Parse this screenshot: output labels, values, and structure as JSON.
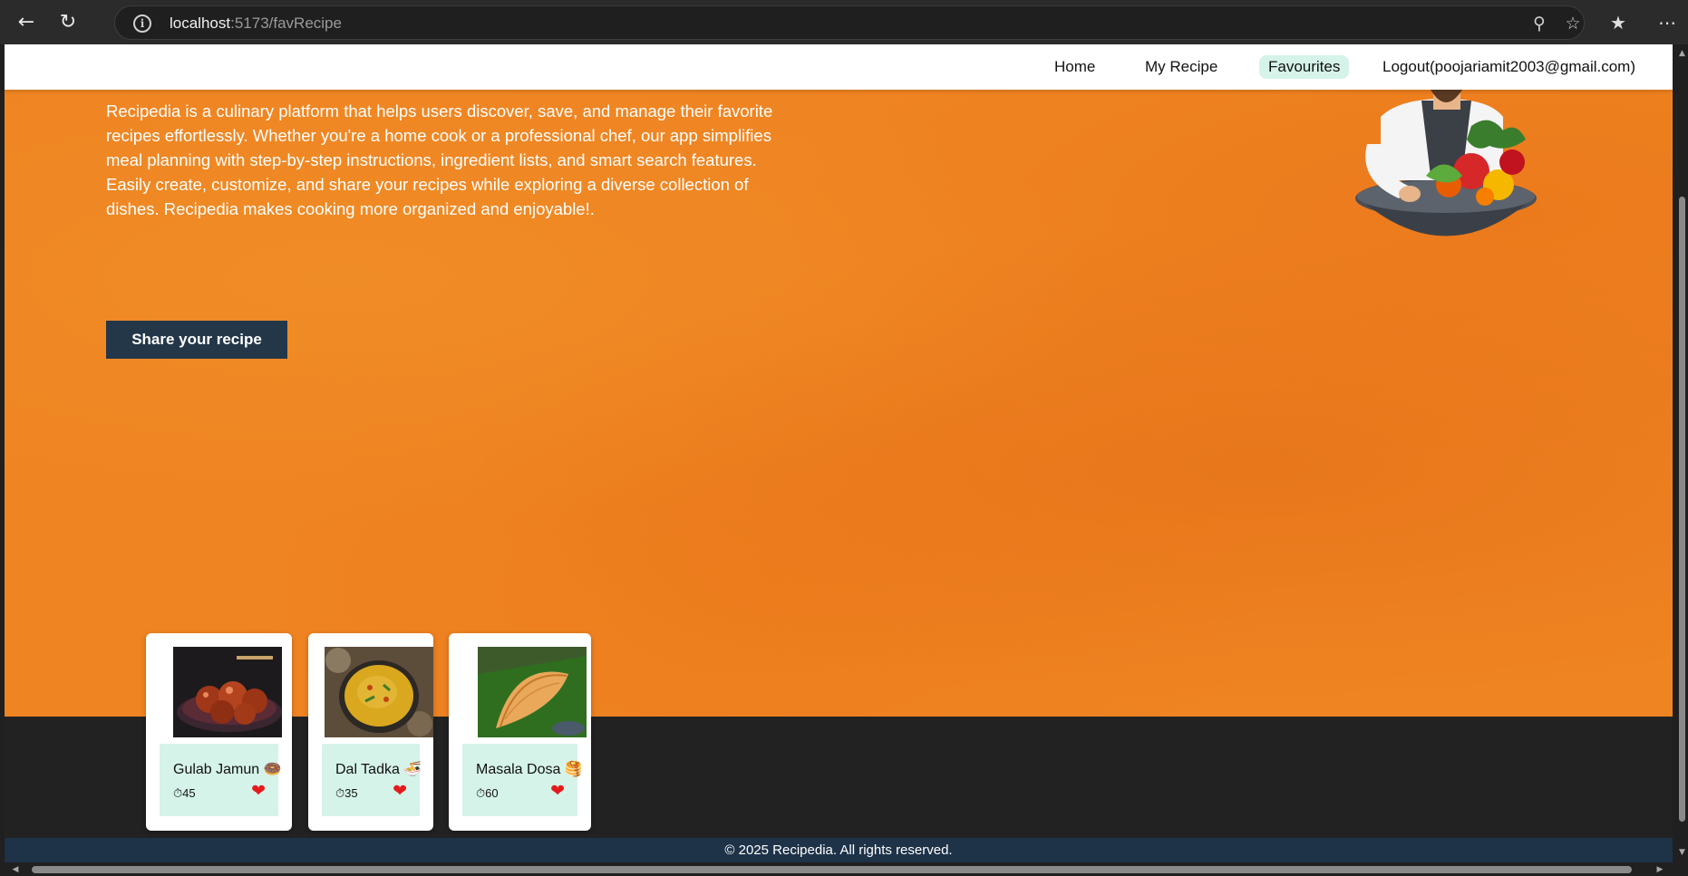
{
  "browser": {
    "url_host": "localhost",
    "url_path": ":5173/favRecipe",
    "back_icon": "back-arrow-icon",
    "reload_icon": "reload-icon",
    "info_icon": "info-icon",
    "zoom_icon": "zoom-out-icon",
    "favorite_icon": "star-icon",
    "favorites_bar_icon": "favorites-icon",
    "menu_icon": "more-icon"
  },
  "navbar": {
    "home": "Home",
    "my_recipe": "My Recipe",
    "favourites": "Favourites",
    "logout": "Logout(poojariamit2003@gmail.com)"
  },
  "hero": {
    "description": "Recipedia is a culinary platform that helps users discover, save, and manage their favorite recipes effortlessly. Whether you're a home cook or a professional chef, our app simplifies meal planning with step-by-step instructions, ingredient lists, and smart search features. Easily create, customize, and share your recipes while exploring a diverse collection of dishes. Recipedia makes cooking more organized and enjoyable!.",
    "share_button": "Share your recipe"
  },
  "recipes": [
    {
      "title": "Gulab Jamun",
      "emoji": "🍩",
      "time_icon": "⏱",
      "time": "45"
    },
    {
      "title": "Dal Tadka",
      "emoji": "🍜",
      "time_icon": "⏱",
      "time": "35"
    },
    {
      "title": "Masala Dosa",
      "emoji": "🥞",
      "time_icon": "⏱",
      "time": "60"
    }
  ],
  "footer": {
    "copyright": "© 2025 Recipedia. All rights reserved."
  },
  "colors": {
    "hero_orange": "#ef8422",
    "navy": "#233749",
    "active_tab": "#d5f3e9",
    "heart": "#e51b1b"
  }
}
